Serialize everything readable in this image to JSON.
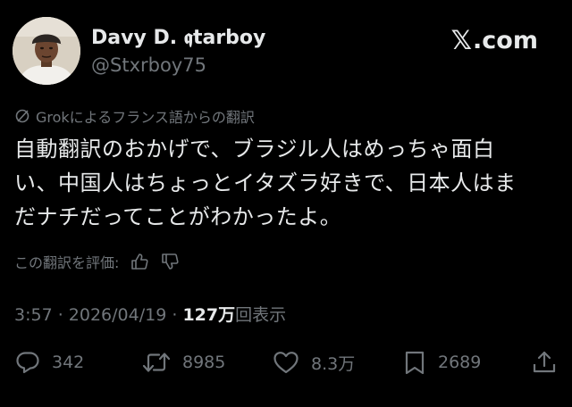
{
  "author": {
    "display_name": "Davy D. 𝖖tarboy",
    "handle": "@Stxrboy75"
  },
  "brand": {
    "x_mark": "𝕏",
    "label": ".com"
  },
  "translation": {
    "label": "Grokによるフランス語からの翻訳"
  },
  "tweet": {
    "lines": [
      "自動翻訳のおかげで、ブラジル人はめっちゃ面白",
      "い、中国人はちょっとイタズラ好きで、日本人はま",
      "だナチだってことがわかったよ。"
    ]
  },
  "rate": {
    "label": "この翻訳を評価:"
  },
  "meta": {
    "time": "3:57",
    "separator": " · ",
    "date": "2026/04/19",
    "views_count": "127万",
    "views_label": "回表示"
  },
  "actions": {
    "replies": "342",
    "reposts": "8985",
    "likes": "8.3万",
    "bookmarks": "2689"
  },
  "icons": {
    "translate": "slashed-circle-icon",
    "thumbs_up": "thumbs-up-icon",
    "thumbs_down": "thumbs-down-icon",
    "reply": "reply-icon",
    "repost": "repost-icon",
    "like": "heart-icon",
    "bookmark": "bookmark-icon",
    "share": "share-icon"
  },
  "colors": {
    "background": "#000000",
    "primary_text": "#e7e9ea",
    "secondary_text": "#71767b"
  }
}
